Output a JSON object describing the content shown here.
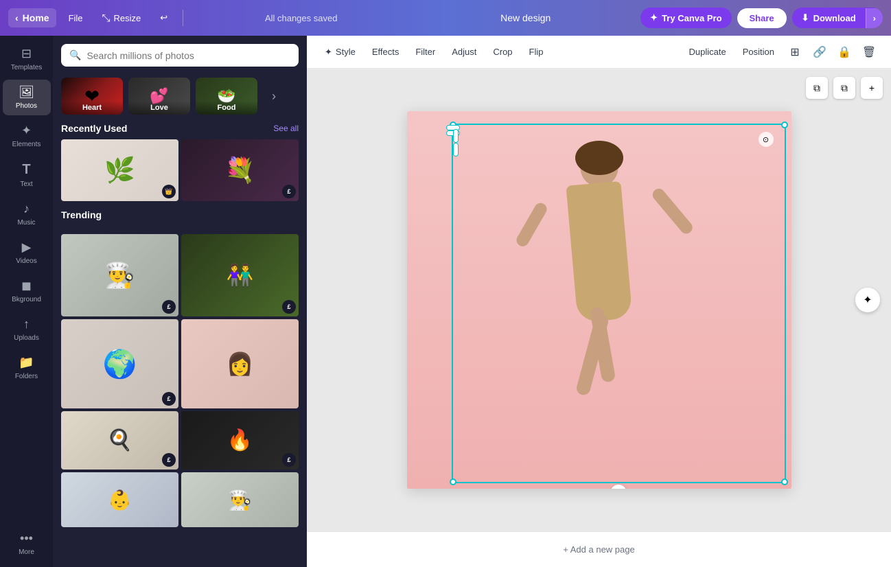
{
  "topbar": {
    "home_label": "Home",
    "file_label": "File",
    "resize_label": "Resize",
    "undo_icon": "↩",
    "saved_label": "All changes saved",
    "design_title": "New design",
    "try_pro_label": "Try Canva Pro",
    "share_label": "Share",
    "download_label": "Download",
    "chevron_icon": "›"
  },
  "toolbar": {
    "style_label": "Style",
    "effects_label": "Effects",
    "filter_label": "Filter",
    "adjust_label": "Adjust",
    "crop_label": "Crop",
    "flip_label": "Flip",
    "duplicate_label": "Duplicate",
    "position_label": "Position",
    "grid_icon": "⊞",
    "link_icon": "🔗",
    "lock_icon": "🔒",
    "trash_icon": "🗑"
  },
  "sidebar": {
    "items": [
      {
        "id": "templates",
        "label": "Templates",
        "icon": "⊟"
      },
      {
        "id": "photos",
        "label": "Photos",
        "icon": "🖼"
      },
      {
        "id": "elements",
        "label": "Elements",
        "icon": "✦"
      },
      {
        "id": "text",
        "label": "Text",
        "icon": "T"
      },
      {
        "id": "music",
        "label": "Music",
        "icon": "♪"
      },
      {
        "id": "videos",
        "label": "Videos",
        "icon": "▶"
      },
      {
        "id": "background",
        "label": "Bkground",
        "icon": "◼"
      },
      {
        "id": "uploads",
        "label": "Uploads",
        "icon": "↑"
      },
      {
        "id": "folders",
        "label": "Folders",
        "icon": "📁"
      },
      {
        "id": "more",
        "label": "More",
        "icon": "•••"
      }
    ]
  },
  "panel": {
    "search_placeholder": "Search millions of photos",
    "categories": [
      {
        "id": "heart",
        "label": "Heart",
        "icon": "❤"
      },
      {
        "id": "love",
        "label": "Love",
        "icon": "💕"
      },
      {
        "id": "food",
        "label": "Food",
        "icon": "🥗"
      }
    ],
    "recently_used_title": "Recently Used",
    "see_all_label": "See all",
    "trending_title": "Trending",
    "photos": {
      "recently_used": [
        {
          "id": "plant",
          "icon": "🌿",
          "badge": "👑",
          "badge_type": "crown"
        },
        {
          "id": "flowers",
          "icon": "💐",
          "badge": "£",
          "badge_type": "e"
        }
      ],
      "trending": [
        {
          "id": "cook",
          "icon": "👨‍🍳",
          "badge": "£",
          "badge_type": "e"
        },
        {
          "id": "couple",
          "icon": "👫",
          "badge": "£",
          "badge_type": "e"
        },
        {
          "id": "globe",
          "icon": "🌍",
          "badge": "£",
          "badge_type": "e"
        },
        {
          "id": "woman",
          "icon": "👩",
          "badge": "",
          "badge_type": ""
        },
        {
          "id": "fireplace",
          "icon": "🔥",
          "badge": "£",
          "badge_type": "e"
        },
        {
          "id": "kitchen",
          "icon": "🍳",
          "badge": "£",
          "badge_type": "e"
        },
        {
          "id": "kids",
          "icon": "👶",
          "badge": "",
          "badge_type": ""
        },
        {
          "id": "chef",
          "icon": "👨‍🍳",
          "badge": "",
          "badge_type": ""
        }
      ]
    }
  },
  "canvas": {
    "add_page_label": "+ Add a new page",
    "rotate_icon": "↻"
  }
}
